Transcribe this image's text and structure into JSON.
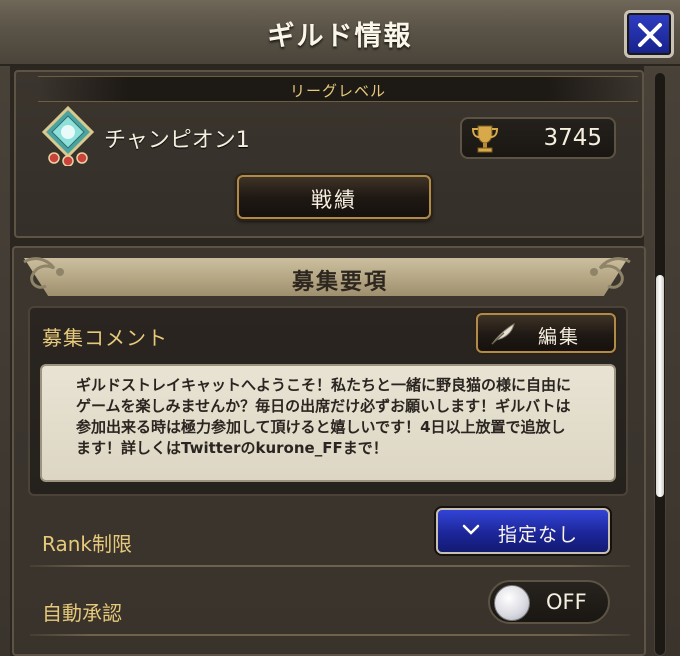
{
  "window": {
    "title": "ギルド情報",
    "close_icon": "close-icon"
  },
  "league": {
    "section_label": "リーグレベル",
    "rank_name": "チャンピオン1",
    "rank_emblem_icon": "champion-emblem-icon",
    "trophy_icon": "trophy-icon",
    "trophy_count": "3745",
    "record_button_label": "戦績"
  },
  "recruit": {
    "section_title": "募集要項",
    "comment_label": "募集コメント",
    "edit_button_label": "編集",
    "edit_icon": "feather-quill-icon",
    "comment_lines": [
      "ギルドストレイキャットへようこそ！私たちと一緒に野良猫の様に自由に",
      "ゲームを楽しみませんか？毎日の出席だけ必ずお願いします！ギルバトは",
      "参加出来る時は極力参加して頂けると嬉しいです！4日以上放置で追放し",
      "ます！詳しくはTwitterのkurone_FFまで！"
    ],
    "rank_limit_label": "Rank制限",
    "rank_limit_value": "指定なし",
    "auto_approve_label": "自動承認",
    "auto_approve_value": "OFF"
  },
  "colors": {
    "accent_gold": "#e6c97a",
    "button_blue": "#1c2699",
    "panel_brown": "#3b352e"
  }
}
